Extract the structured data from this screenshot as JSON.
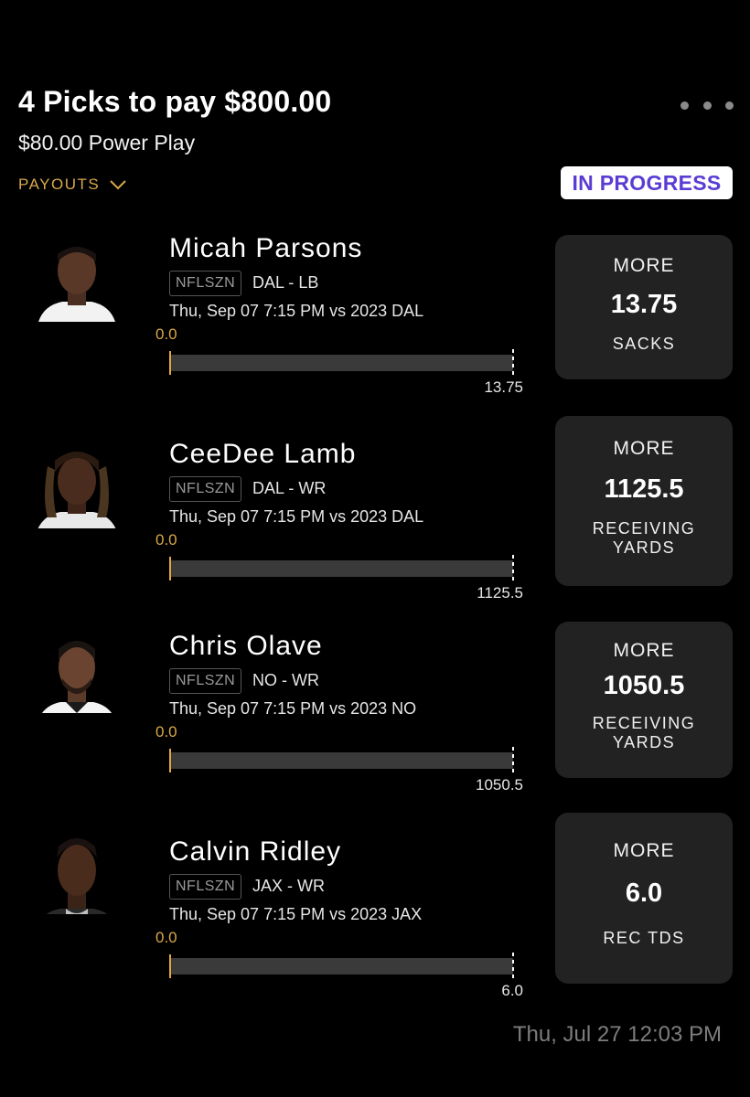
{
  "header": {
    "title": "4 Picks to pay $800.00",
    "subtitle": "$80.00 Power Play",
    "payouts_label": "PAYOUTS",
    "status": "IN PROGRESS"
  },
  "picks": [
    {
      "name": "Micah Parsons",
      "league": "NFLSZN",
      "team_pos": "DAL - LB",
      "game": "Thu, Sep 07 7:15 PM  vs 2023 DAL",
      "current": "0.0",
      "target": "13.75",
      "direction": "MORE",
      "line": "13.75",
      "stat": "SACKS",
      "progress": 0
    },
    {
      "name": "CeeDee Lamb",
      "league": "NFLSZN",
      "team_pos": "DAL - WR",
      "game": "Thu, Sep 07 7:15 PM  vs 2023 DAL",
      "current": "0.0",
      "target": "1125.5",
      "direction": "MORE",
      "line": "1125.5",
      "stat": "RECEIVING YARDS",
      "progress": 0
    },
    {
      "name": "Chris Olave",
      "league": "NFLSZN",
      "team_pos": "NO - WR",
      "game": "Thu, Sep 07 7:15 PM  vs 2023 NO",
      "current": "0.0",
      "target": "1050.5",
      "direction": "MORE",
      "line": "1050.5",
      "stat": "RECEIVING YARDS",
      "progress": 0
    },
    {
      "name": "Calvin Ridley",
      "league": "NFLSZN",
      "team_pos": "JAX - WR",
      "game": "Thu, Sep 07 7:15 PM  vs 2023 JAX",
      "current": "0.0",
      "target": "6.0",
      "direction": "MORE",
      "line": "6.0",
      "stat": "REC TDS",
      "progress": 0
    }
  ],
  "footer": {
    "timestamp": "Thu, Jul 27 12:03 PM"
  },
  "colors": {
    "accent_gold": "#d9a84a",
    "status_purple": "#5a3cd4",
    "card_bg": "#222222",
    "track_bg": "#3a3a3a"
  },
  "icons": {
    "menu": "more-dots-icon",
    "payouts": "chevron-down-icon"
  }
}
